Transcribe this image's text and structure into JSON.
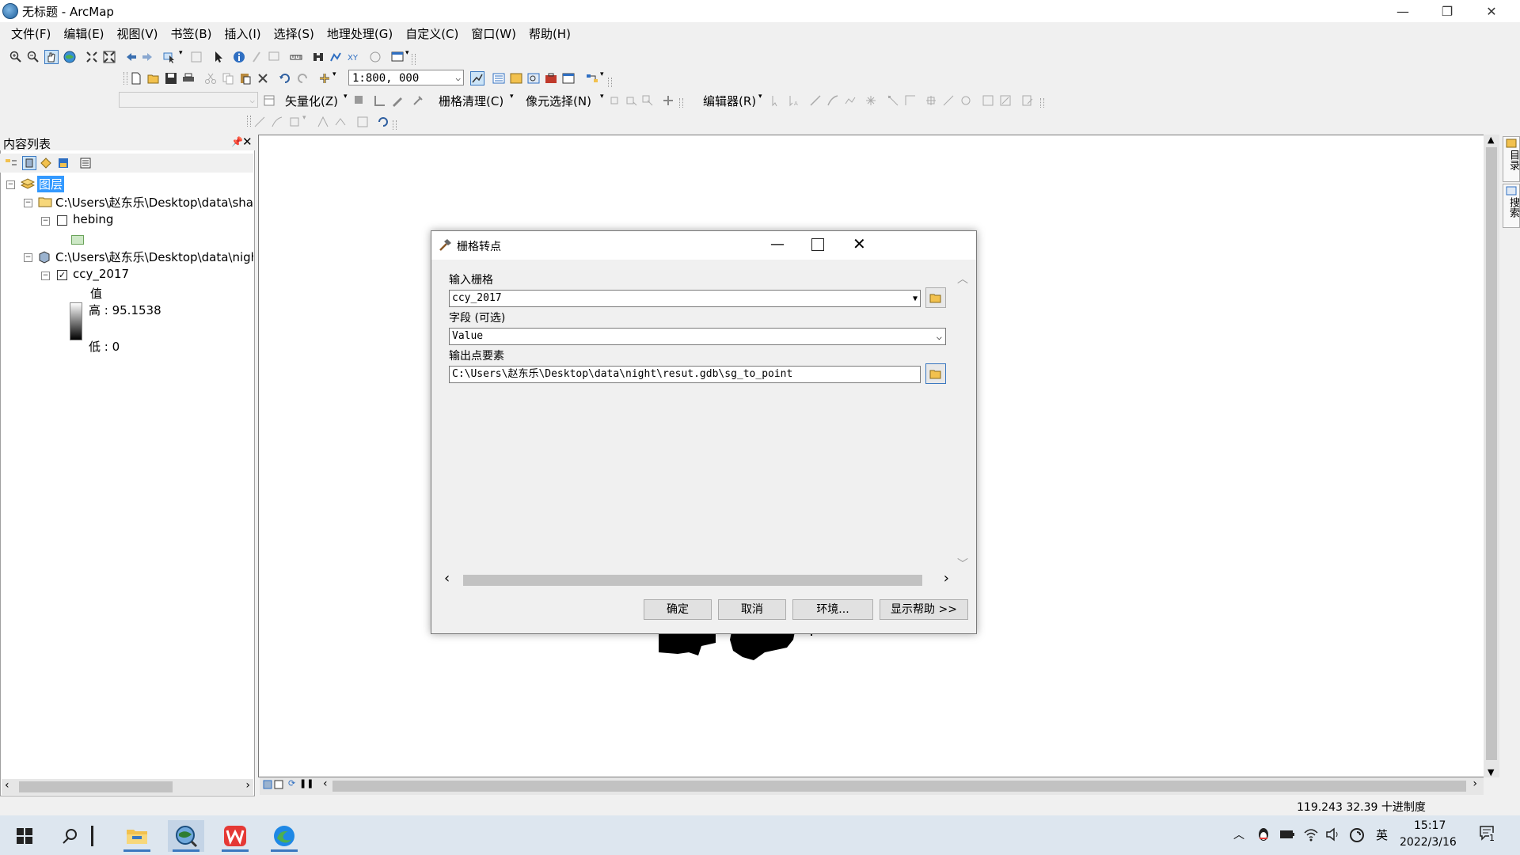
{
  "window": {
    "title": "无标题 - ArcMap",
    "controls": {
      "minimize": "—",
      "restore": "❐",
      "close": "✕"
    }
  },
  "menu": [
    "文件(F)",
    "编辑(E)",
    "视图(V)",
    "书签(B)",
    "插入(I)",
    "选择(S)",
    "地理处理(G)",
    "自定义(C)",
    "窗口(W)",
    "帮助(H)"
  ],
  "toolbar": {
    "scale_value": "1:800, 000",
    "vectorize_label": "矢量化(Z)",
    "raster_cleanup_label": "栅格清理(C)",
    "cell_select_label": "像元选择(N)",
    "editor_label": "编辑器(R)"
  },
  "toc": {
    "title": "内容列表",
    "root_label": "图层",
    "group1_path": "C:\\Users\\赵东乐\\Desktop\\data\\shap",
    "layer1_name": "hebing",
    "group2_path": "C:\\Users\\赵东乐\\Desktop\\data\\nigh",
    "layer2_name": "ccy_2017",
    "legend_value_label": "值",
    "legend_high": "高 : 95.1538",
    "legend_low": "低 : 0"
  },
  "dialog": {
    "title": "栅格转点",
    "input_raster_label": "输入栅格",
    "input_raster_value": "ccy_2017",
    "field_label": "字段 (可选)",
    "field_value": "Value",
    "output_label": "输出点要素",
    "output_value": "C:\\Users\\赵东乐\\Desktop\\data\\night\\resut.gdb\\sg_to_point",
    "ok_label": "确定",
    "cancel_label": "取消",
    "env_label": "环境...",
    "help_label": "显示帮助 >>"
  },
  "statusbar": {
    "coords": "119.243  32.39 十进制度"
  },
  "taskbar": {
    "time": "15:17",
    "date": "2022/3/16",
    "ime": "英",
    "notification_count": "1"
  },
  "side_tabs": [
    "目录",
    "搜索"
  ],
  "colors": {
    "taskbar_bg": "#dde6ef",
    "selected_bg": "#3399ff",
    "accent_blue": "#3a78c0"
  }
}
